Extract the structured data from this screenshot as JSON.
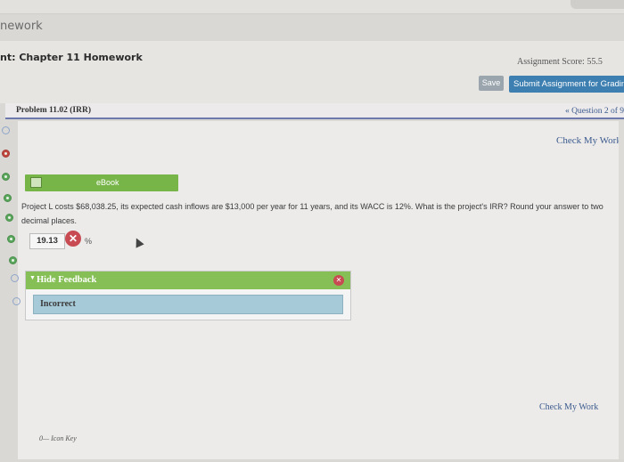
{
  "breadcrumb": "nework",
  "assignment": {
    "title": "nt: Chapter 11 Homework",
    "score_text": "Assignment Score: 55.5",
    "save_label": "Save",
    "submit_label": "Submit Assignment for Gradin"
  },
  "problem": {
    "label": "Problem 11.02 (IRR)",
    "question_nav": "« Question 2 of 9"
  },
  "check_my_work_top": "Check My Work",
  "ebook_label": "eBook",
  "question_text": "Project L costs $68,038.25, its expected cash inflows are $13,000 per year for 11 years, and its WACC is 12%. What is the project's IRR? Round your answer to two decimal places.",
  "answer": {
    "value": "19.13",
    "unit": "%",
    "status_icon": "x-icon"
  },
  "feedback": {
    "toggle_label": "Hide Feedback",
    "result": "Incorrect"
  },
  "check_my_work_bottom": "Check My Work",
  "icon_key": "Icon Key",
  "colors": {
    "green": "#78b548",
    "blue_button": "#3d7fb0",
    "incorrect_bg": "#a7cad8",
    "error_red": "#c84a52"
  }
}
